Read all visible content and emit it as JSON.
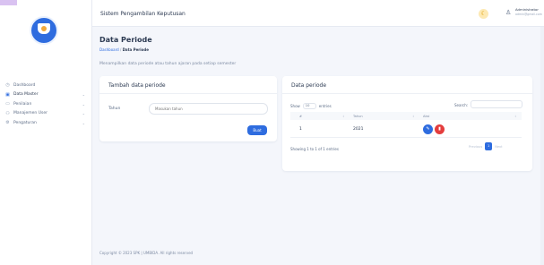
{
  "app": {
    "title": "Sistem Pengambilan Keputusan"
  },
  "user": {
    "name": "Administrator",
    "email": "admin@gmail.com"
  },
  "sidebar": {
    "items": [
      {
        "label": "Dashboard",
        "icon": "dashboard-icon",
        "has_children": false
      },
      {
        "label": "Data Master",
        "icon": "database-icon",
        "has_children": true
      },
      {
        "label": "Penilaian",
        "icon": "clipboard-icon",
        "has_children": true
      },
      {
        "label": "Manajemen User",
        "icon": "users-icon",
        "has_children": true
      },
      {
        "label": "Pengaturan",
        "icon": "gear-icon",
        "has_children": true
      }
    ]
  },
  "page": {
    "title": "Data Periode",
    "breadcrumb": [
      "Dashboard",
      "Data Periode"
    ],
    "subtitle": "Menampilkan data periode atau tahun ajaran pada setiap semester"
  },
  "form": {
    "title": "Tambah data periode",
    "tahun_label": "Tahun",
    "tahun_placeholder": "Masukan tahun",
    "submit_label": "Buat"
  },
  "table": {
    "title": "Data periode",
    "show_label": "Show",
    "entries_value": "10",
    "entries_label": "entries",
    "search_label": "Search:",
    "columns": [
      "#",
      "Tahun",
      "Aksi"
    ],
    "rows": [
      {
        "no": "1",
        "tahun": "2021"
      }
    ],
    "info": "Showing 1 to 1 of 1 entries",
    "pager": {
      "previous": "Previous",
      "current": "1",
      "next": "Next"
    }
  },
  "footer": {
    "text": "Copyright © 2023 SPK | UMBIDA. All rights reserved"
  },
  "colors": {
    "primary": "#2e6cdf",
    "danger": "#e43d3d",
    "warning": "#f0b429"
  }
}
